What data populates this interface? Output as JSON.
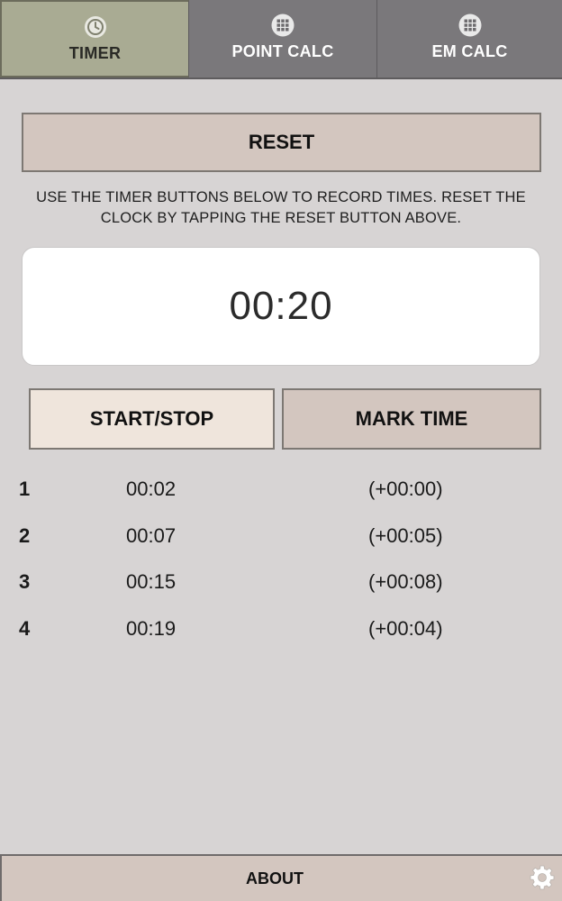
{
  "tabs": [
    {
      "label": "TIMER",
      "icon": "clock-icon",
      "active": true
    },
    {
      "label": "POINT CALC",
      "icon": "grid-icon",
      "active": false
    },
    {
      "label": "EM CALC",
      "icon": "grid-icon",
      "active": false
    }
  ],
  "reset": {
    "label": "RESET"
  },
  "instructions": "USE THE TIMER BUTTONS BELOW TO RECORD TIMES. RESET THE CLOCK BY TAPPING THE RESET BUTTON ABOVE.",
  "clock": {
    "display": "00:20"
  },
  "controls": {
    "start_stop_label": "START/STOP",
    "mark_time_label": "MARK TIME"
  },
  "marks": [
    {
      "index": "1",
      "time": "00:02",
      "delta": "(+00:00)"
    },
    {
      "index": "2",
      "time": "00:07",
      "delta": "(+00:05)"
    },
    {
      "index": "3",
      "time": "00:15",
      "delta": "(+00:08)"
    },
    {
      "index": "4",
      "time": "00:19",
      "delta": "(+00:04)"
    }
  ],
  "footer": {
    "about_label": "ABOUT",
    "settings_icon": "gear-icon"
  },
  "colors": {
    "active_tab": "#a9ab93",
    "inactive_tab": "#7a787b",
    "button": "#d3c6bf",
    "start_button": "#efe5dc",
    "background": "#d7d4d4"
  }
}
